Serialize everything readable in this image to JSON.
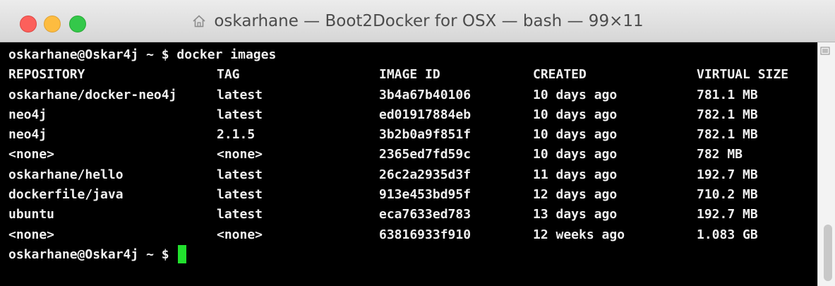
{
  "window": {
    "title": "oskarhane — Boot2Docker for OSX — bash — 99×11",
    "icon": "home-icon"
  },
  "terminal": {
    "command_prompt": "oskarhane@Oskar4j ~ $ docker images",
    "header": [
      "REPOSITORY",
      "TAG",
      "IMAGE ID",
      "CREATED",
      "VIRTUAL SIZE"
    ],
    "rows": [
      [
        "oskarhane/docker-neo4j",
        "latest",
        "3b4a67b40106",
        "10 days ago",
        "781.1 MB"
      ],
      [
        "neo4j",
        "latest",
        "ed01917884eb",
        "10 days ago",
        "782.1 MB"
      ],
      [
        "neo4j",
        "2.1.5",
        "3b2b0a9f851f",
        "10 days ago",
        "782.1 MB"
      ],
      [
        "<none>",
        "<none>",
        "2365ed7fd59c",
        "10 days ago",
        "782 MB"
      ],
      [
        "oskarhane/hello",
        "latest",
        "26c2a2935d3f",
        "11 days ago",
        "192.7 MB"
      ],
      [
        "dockerfile/java",
        "latest",
        "913e453bd95f",
        "12 days ago",
        "710.2 MB"
      ],
      [
        "ubuntu",
        "latest",
        "eca7633ed783",
        "13 days ago",
        "192.7 MB"
      ],
      [
        "<none>",
        "<none>",
        "63816933f910",
        "12 weeks ago",
        "1.083 GB"
      ]
    ],
    "final_prompt": "oskarhane@Oskar4j ~ $ ",
    "cursor_color": "#22e02e"
  },
  "colors": {
    "terminal_bg": "#000000",
    "terminal_text": "#f0f0f0",
    "close": "#fc605b",
    "minimize": "#fdbc40",
    "zoom": "#34c84a"
  }
}
